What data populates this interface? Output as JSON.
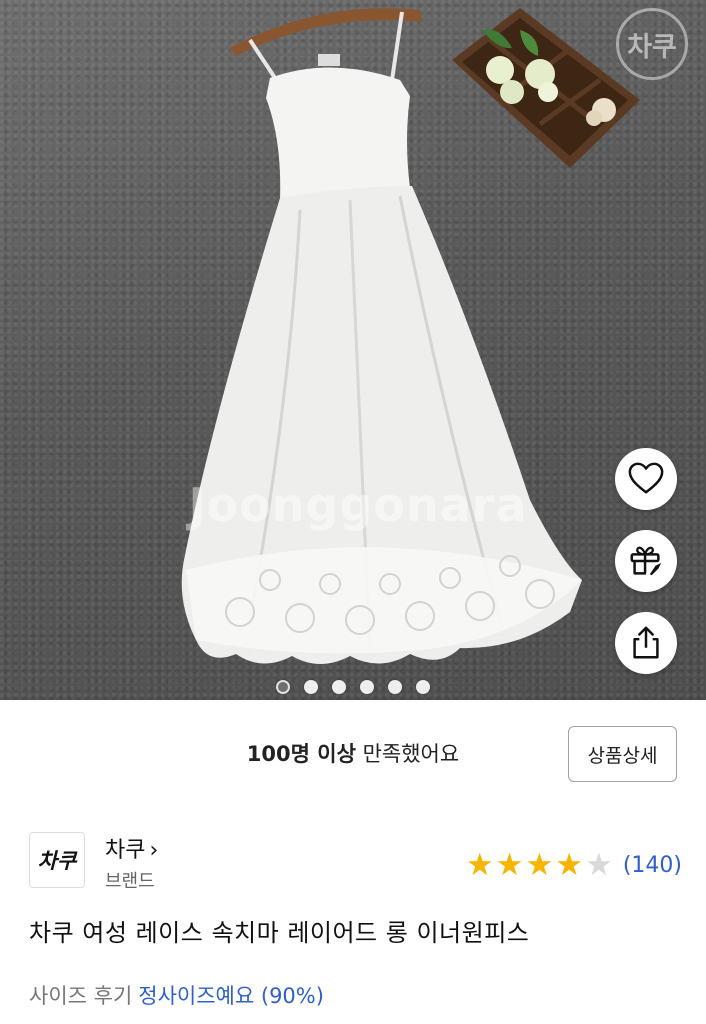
{
  "product_image": {
    "watermark": "Joonggonara",
    "brand_stamp": "차쿠",
    "slides_total": 6,
    "active_slide": 1,
    "colors": {
      "background": "#5f5f5f",
      "dress": "#f4f4f2",
      "tray": "#5a3a22"
    }
  },
  "actions": {
    "wishlist_icon": "heart-icon",
    "gift_icon": "gift-icon",
    "share_icon": "share-icon"
  },
  "satisfaction": {
    "bold": "100명 이상",
    "text": " 만족했어요",
    "detail_button": "상품상세"
  },
  "brand": {
    "logo_text": "차쿠",
    "name": "차쿠",
    "chevron": "›",
    "type": "브랜드"
  },
  "rating": {
    "stars_filled": 4,
    "stars_total": 5,
    "count": "(140)",
    "star_color": "#f7b500",
    "link_color": "#2f5fd0"
  },
  "product": {
    "title": "차쿠 여성 레이스 속치마 레이어드 롱 이너원피스"
  },
  "size_review": {
    "label": "사이즈 후기",
    "value": "정사이즈예요 (90%)"
  }
}
